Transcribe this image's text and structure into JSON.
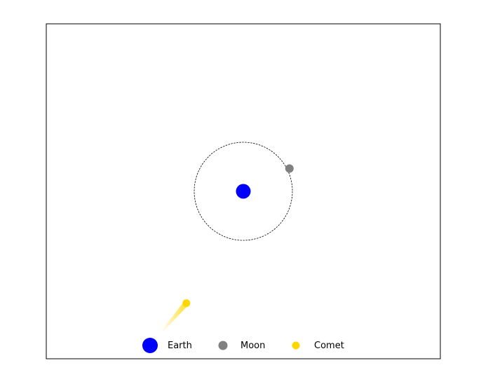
{
  "chart_data": {
    "type": "scatter",
    "xlim": [
      -10,
      10
    ],
    "ylim": [
      -10,
      10
    ],
    "axes_ticks": "hidden",
    "grid": false,
    "legend": {
      "placement": "lower-center",
      "entries": [
        "Earth",
        "Moon",
        "Comet"
      ]
    },
    "series": [
      {
        "name": "Earth",
        "color": "#0000ff",
        "x": [
          0.0
        ],
        "y": [
          0.0
        ]
      },
      {
        "name": "Moon",
        "color": "#808080",
        "x": [
          2.35
        ],
        "y": [
          1.16
        ]
      },
      {
        "name": "Comet",
        "color": "#ffd700",
        "x": [
          -2.9
        ],
        "y": [
          -5.7
        ]
      }
    ],
    "orbit": {
      "center": [
        0,
        0
      ],
      "radius": 2.5,
      "style": "dashed",
      "color": "#000000"
    },
    "comet_tail": {
      "from": [
        -2.9,
        -5.7
      ],
      "to": [
        -4.7,
        -7.8
      ],
      "color": "#ffd700"
    }
  }
}
